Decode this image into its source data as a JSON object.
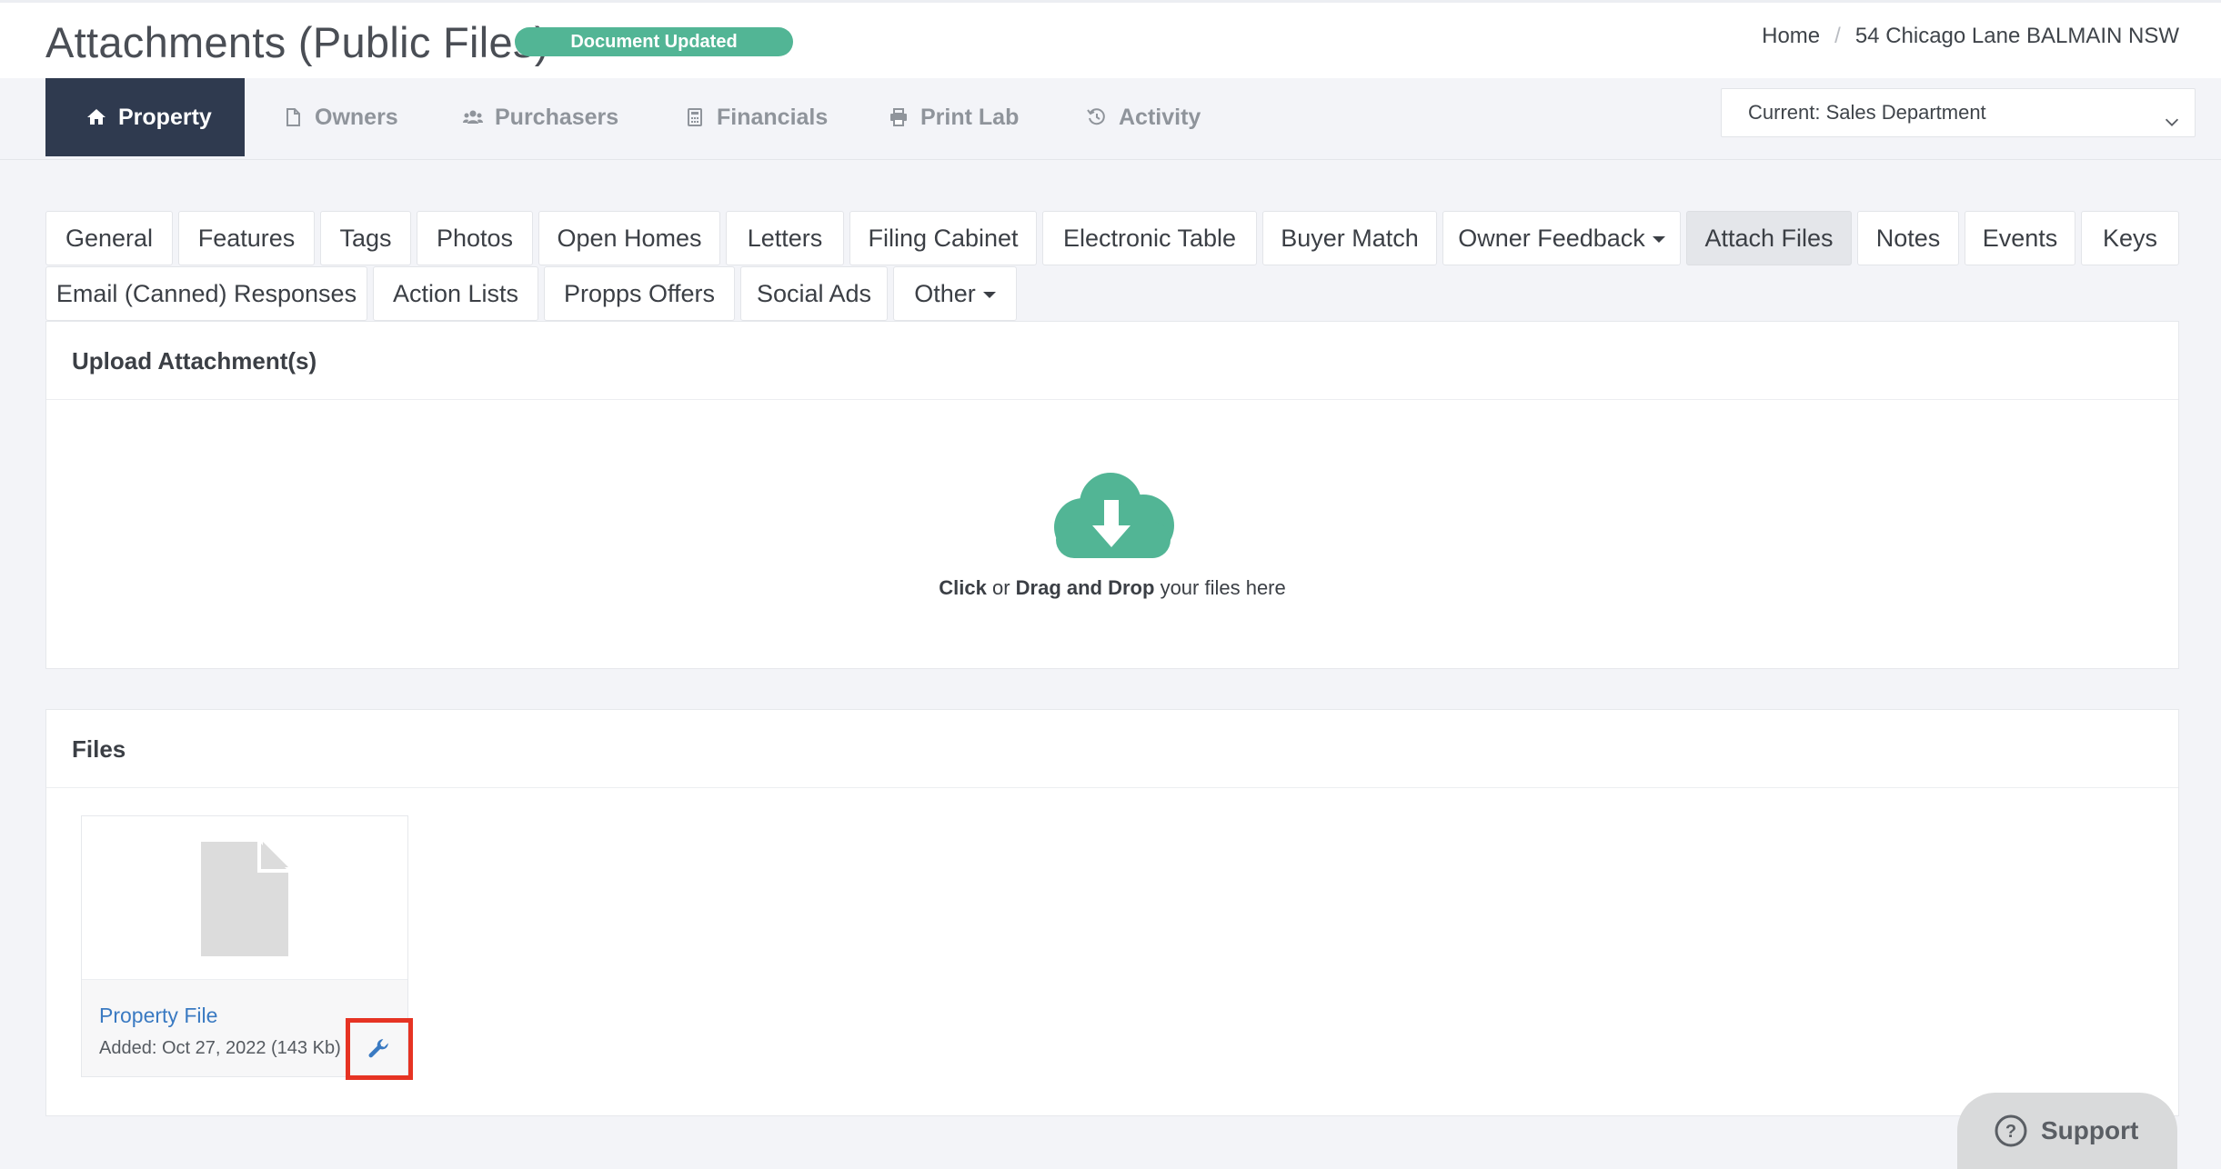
{
  "header": {
    "title": "Attachments (Public Files)",
    "status_badge": "Document Updated",
    "breadcrumb": {
      "home": "Home",
      "separator": "/",
      "current": "54 Chicago Lane BALMAIN NSW"
    }
  },
  "main_nav": {
    "items": [
      {
        "label": "Property",
        "icon": "home-icon",
        "active": true
      },
      {
        "label": "Owners",
        "icon": "document-icon"
      },
      {
        "label": "Purchasers",
        "icon": "users-icon"
      },
      {
        "label": "Financials",
        "icon": "calculator-icon"
      },
      {
        "label": "Print Lab",
        "icon": "printer-icon"
      },
      {
        "label": "Activity",
        "icon": "history-icon"
      }
    ],
    "department_select": {
      "value": "Current: Sales Department"
    }
  },
  "sub_tabs": {
    "row1": [
      "General",
      "Features",
      "Tags",
      "Photos",
      "Open Homes",
      "Letters",
      "Filing Cabinet",
      "Electronic Table",
      "Buyer Match",
      "Owner Feedback",
      "Attach Files",
      "Notes",
      "Events",
      "Keys"
    ],
    "row2": [
      "Email (Canned) Responses",
      "Action Lists",
      "Propps Offers",
      "Social Ads",
      "Other"
    ],
    "active": "Attach Files"
  },
  "upload_panel": {
    "title": "Upload Attachment(s)",
    "drop_click": "Click",
    "drop_or": "or",
    "drop_drag": "Drag and Drop",
    "drop_rest": "your files here"
  },
  "files_panel": {
    "title": "Files",
    "files": [
      {
        "name": "Property File",
        "added": "Added: Oct 27, 2022 (143 Kb)"
      }
    ]
  },
  "support": {
    "label": "Support"
  },
  "colors": {
    "accent_green": "#52b595",
    "nav_active_bg": "#2f3a4f",
    "link_blue": "#3a7ac2",
    "highlight_red": "#e63323"
  }
}
